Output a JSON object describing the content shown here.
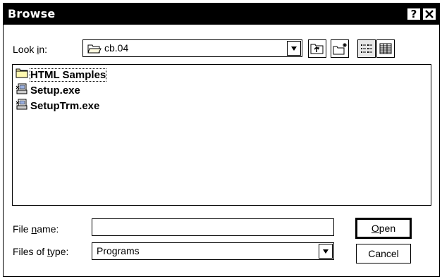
{
  "window": {
    "title": "Browse",
    "help_glyph": "?",
    "close_glyph": "x"
  },
  "lookin": {
    "label_pre": "Look ",
    "label_acc": "i",
    "label_post": "n:",
    "value": "cb.04"
  },
  "toolbar": {
    "buttons": [
      "up-one-level",
      "create-new-folder",
      "list-view",
      "details-view"
    ]
  },
  "files": [
    {
      "name": "HTML Samples",
      "type": "folder",
      "selected": true
    },
    {
      "name": "Setup.exe",
      "type": "program",
      "selected": false
    },
    {
      "name": "SetupTrm.exe",
      "type": "program",
      "selected": false
    }
  ],
  "filename": {
    "label_pre": "File ",
    "label_acc": "n",
    "label_post": "ame:",
    "value": ""
  },
  "filetype": {
    "label_pre": "Files of ",
    "label_acc": "t",
    "label_post": "ype:",
    "value": "Programs"
  },
  "buttons": {
    "open_acc": "O",
    "open_rest": "pen",
    "cancel": "Cancel"
  }
}
